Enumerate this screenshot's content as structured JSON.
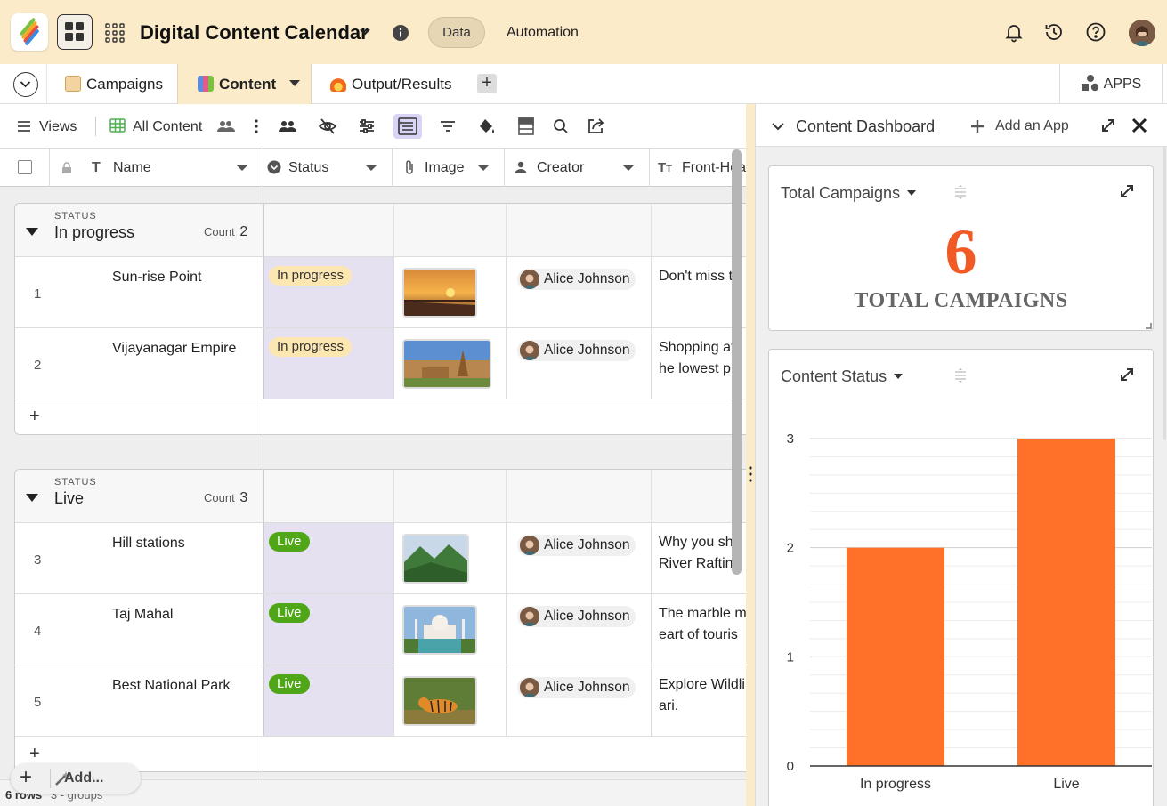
{
  "topbar": {
    "title": "Digital Content Calendar",
    "tabs": [
      "Data",
      "Automation"
    ],
    "active_tab": "Data"
  },
  "table_tabs": {
    "items": [
      {
        "label": "Campaigns",
        "icon": "scroll-icon"
      },
      {
        "label": "Content",
        "icon": "books-icon"
      },
      {
        "label": "Output/Results",
        "icon": "fire-icon"
      }
    ],
    "active": "Content",
    "apps_label": "APPS"
  },
  "toolbar": {
    "views_label": "Views",
    "view_name": "All Content"
  },
  "grid": {
    "columns": [
      "Name",
      "Status",
      "Image",
      "Creator",
      "Front-Hea"
    ],
    "group_label": "STATUS",
    "count_label": "Count",
    "groups": [
      {
        "name": "In progress",
        "count": "2",
        "rows": [
          {
            "num": "1",
            "name": "Sun-rise Point",
            "status": "In progress",
            "creator": "Alice Johnson",
            "front": [
              "Don't miss t"
            ]
          },
          {
            "num": "2",
            "name": "Vijayanagar Empire",
            "status": "In progress",
            "creator": "Alice Johnson",
            "front": [
              "Shopping at",
              "he lowest pr"
            ]
          }
        ]
      },
      {
        "name": "Live",
        "count": "3",
        "rows": [
          {
            "num": "3",
            "name": "Hill stations",
            "status": "Live",
            "creator": "Alice Johnson",
            "front": [
              "Why you sho",
              " River Rafting"
            ]
          },
          {
            "num": "4",
            "name": "Taj Mahal",
            "status": "Live",
            "creator": "Alice Johnson",
            "front": [
              "The marble m",
              "eart of touris"
            ]
          },
          {
            "num": "5",
            "name": "Best National Park",
            "status": "Live",
            "creator": "Alice Johnson",
            "front": [
              "Explore Wildli",
              "ari."
            ]
          }
        ]
      }
    ],
    "add_row": "+",
    "footer": "6 rows",
    "footer_groups": "3 - groups",
    "add_button": "Add..."
  },
  "panel": {
    "title": "Content Dashboard",
    "add_app": "Add an App",
    "metric_card": {
      "title": "Total Campaigns",
      "value": "6",
      "label": "TOTAL CAMPAIGNS"
    },
    "chart_card": {
      "title": "Content Status"
    }
  },
  "colors": {
    "topbar": "#fcebc9",
    "accent_orange": "#ff7029",
    "metric_orange": "#f15a24",
    "live_green": "#4fa617",
    "in_progress_yellow": "#fce7b3"
  },
  "chart_data": {
    "type": "bar",
    "categories": [
      "In progress",
      "Live"
    ],
    "values": [
      2,
      3
    ],
    "title": "",
    "xlabel": "",
    "ylabel": "",
    "ylim": [
      0,
      3
    ],
    "yticks": [
      0,
      1,
      2,
      3
    ],
    "grid": true,
    "color": "#ff7029"
  }
}
